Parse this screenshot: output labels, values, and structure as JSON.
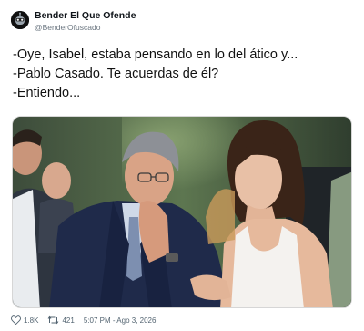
{
  "tweet": {
    "author_name": "Bender El Que Ofende",
    "author_handle": "@BenderOfuscado",
    "lines": [
      "-Oye, Isabel, estaba pensando en lo del ático y...",
      "-Pablo Casado. Te acuerdas de él?",
      "-Entiendo..."
    ],
    "likes": "1.8K",
    "retweets": "421",
    "timestamp": "5:07 PM - Ago 3, 2026"
  },
  "icons": {
    "avatar": "bender-avatar-icon",
    "like": "heart-icon",
    "retweet": "retweet-icon"
  },
  "colors": {
    "text": "#0f1419",
    "muted": "#536471"
  }
}
